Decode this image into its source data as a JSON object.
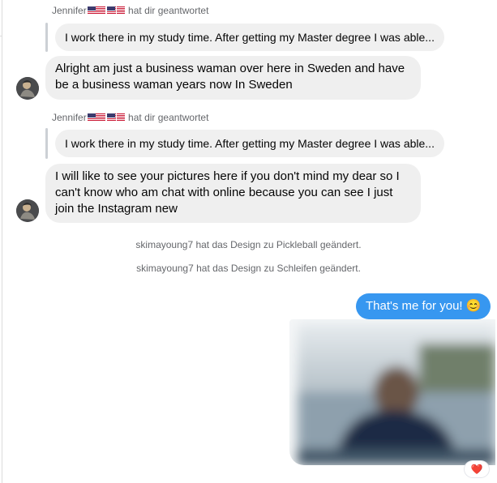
{
  "thread": {
    "messages": [
      {
        "reply_header": {
          "name": "Jennifer",
          "suffix": "hat dir geantwortet"
        },
        "quoted_text": "I work there in my study time. After getting my Master degree I was able...",
        "text": "Alright am just a business waman over here in Sweden and have be a business waman years now In Sweden"
      },
      {
        "reply_header": {
          "name": "Jennifer",
          "suffix": "hat dir geantwortet"
        },
        "quoted_text": "I work there in my study time. After getting my Master degree I was able...",
        "text": "I will like to see your pictures here if you don't mind my dear so I can't know who am chat with online because you can see I just join the Instagram new"
      }
    ],
    "system_events": [
      "skimayoung7 hat das Design zu Pickleball geändert.",
      "skimayoung7 hat das Design zu Schleifen geändert."
    ],
    "sent_message": "That's me for you! 😊",
    "reaction": "❤️"
  },
  "colors": {
    "sent_bubble": "#3797f0",
    "received_bubble": "#efefef",
    "meta_text": "#65676b"
  },
  "icons": [
    "us-flag-icon",
    "heart-reaction-icon"
  ]
}
